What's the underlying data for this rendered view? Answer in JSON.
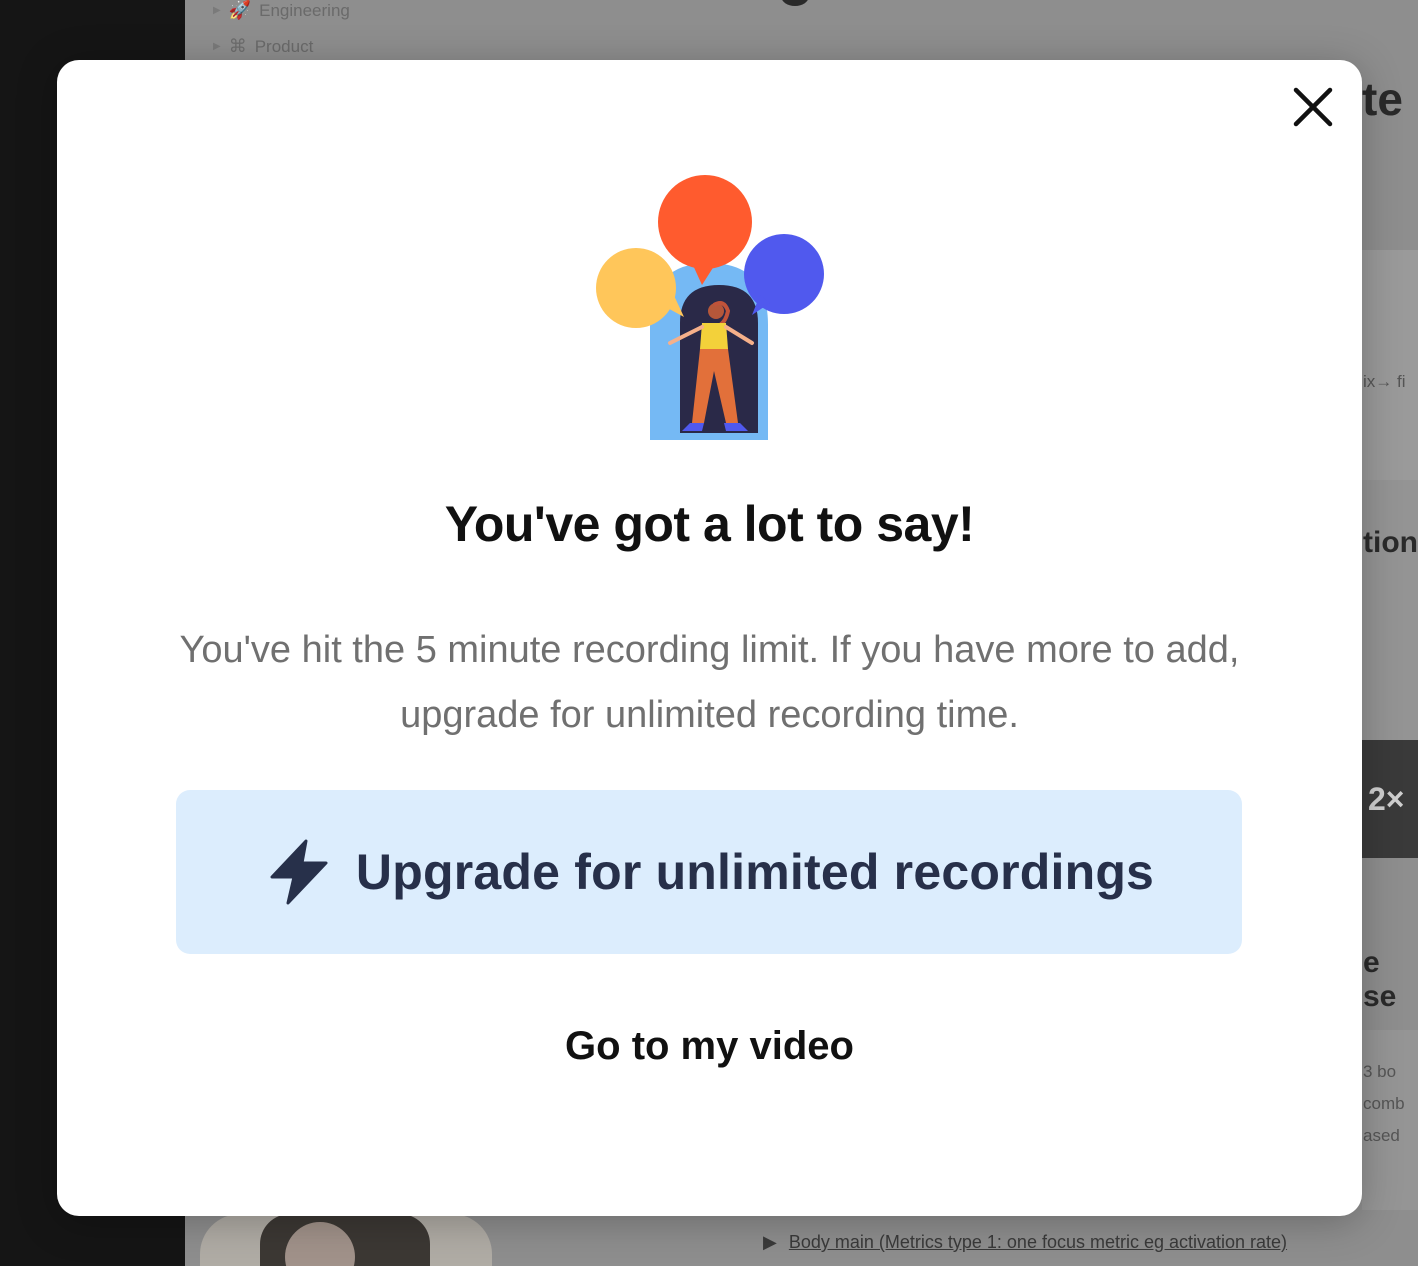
{
  "background": {
    "nav_items": [
      {
        "label": "Engineering",
        "icon": "rocket-icon",
        "glyph": "🚀"
      },
      {
        "label": "Product",
        "icon": "network-icon",
        "glyph": "⌘"
      }
    ],
    "right_texts": {
      "heading_1": "te",
      "arrow_text": "ix→ fi",
      "heading_2": "tion",
      "speed": "2×",
      "heading_3": "e se",
      "line_1": "3 bo",
      "line_2": "comb",
      "line_3": "ased"
    },
    "bottom_link": "Body main (Metrics type 1: one focus metric eg activation rate)"
  },
  "modal": {
    "close_icon": "close-icon",
    "illustration": "person-with-speech-bubbles-illustration",
    "title": "You've got a lot to say!",
    "body": "You've hit the 5 minute recording limit. If you have more to add, upgrade for unlimited recording time.",
    "upgrade_button": {
      "icon": "lightning-bolt-icon",
      "label": "Upgrade for unlimited recordings"
    },
    "secondary_link": "Go to my video",
    "colors": {
      "button_bg": "#dcedfd",
      "button_text": "#27304a",
      "bubble_orange": "#ff5b2e",
      "bubble_yellow": "#ffc65a",
      "bubble_blue": "#5059ee",
      "arch_blue": "#75b9f4",
      "arch_dark": "#2a2948"
    }
  }
}
